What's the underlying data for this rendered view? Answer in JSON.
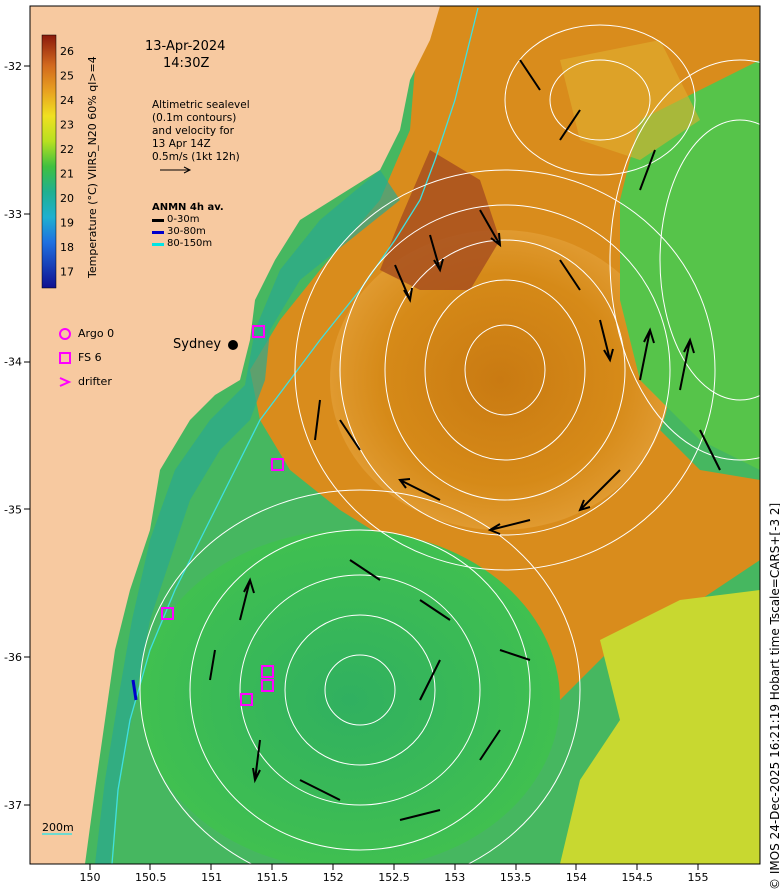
{
  "map": {
    "date": "13-Apr-2024",
    "time": "14:30Z",
    "altimetry_lines": [
      "Altimetric sealevel",
      "(0.1m contours)",
      "and velocity for",
      "13 Apr 14Z",
      "0.5m/s (1kt 12h)"
    ],
    "anmn": {
      "title": "ANMN 4h av.",
      "items": [
        {
          "label": "0-30m",
          "color": "#000000"
        },
        {
          "label": "30-80m",
          "color": "#0000cc"
        },
        {
          "label": "80-150m",
          "color": "#00e5e5"
        }
      ]
    },
    "colorbar": {
      "title": "Temperature (°C) VIIRS_N20 60% ql>=4",
      "ticks": [
        "26",
        "25",
        "24",
        "23",
        "22",
        "21",
        "20",
        "19",
        "18",
        "17"
      ]
    },
    "legend": [
      {
        "label": "Argo 0",
        "icon": "circle-icon"
      },
      {
        "label": "FS 6",
        "icon": "square-icon"
      },
      {
        "label": "drifter",
        "icon": "chevron-right-icon"
      }
    ],
    "place_label": "Sydney",
    "scale_label": "200m",
    "lon_ticks": [
      "150",
      "150.5",
      "151",
      "151.5",
      "152",
      "152.5",
      "153",
      "153.5",
      "154",
      "154.5",
      "155"
    ],
    "lat_ticks": [
      "-32",
      "-33",
      "-34",
      "-35",
      "-36",
      "-37"
    ],
    "copyright": "© IMOS 24-Dec-2025 16:21:19 Hobart time Tscale=CARS+[-3 2]",
    "colors": {
      "land": "#f7c9a0",
      "warm": "#d8860a",
      "cool": "#3fbf5a",
      "contour": "#ffffff",
      "marker": "#ff00ff"
    }
  }
}
